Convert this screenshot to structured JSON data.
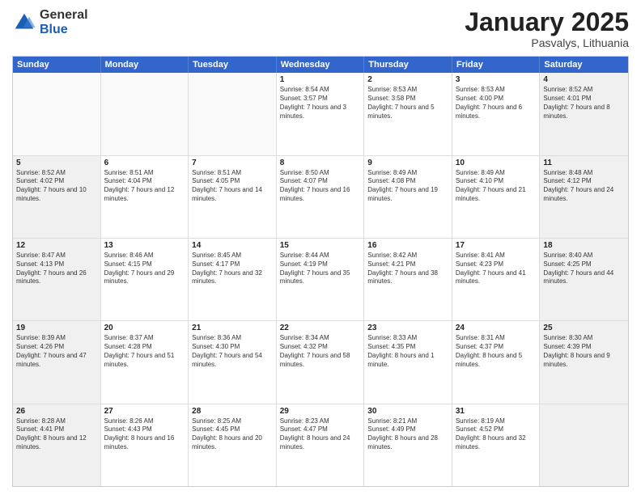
{
  "logo": {
    "general": "General",
    "blue": "Blue"
  },
  "header": {
    "title": "January 2025",
    "subtitle": "Pasvalys, Lithuania"
  },
  "weekdays": [
    "Sunday",
    "Monday",
    "Tuesday",
    "Wednesday",
    "Thursday",
    "Friday",
    "Saturday"
  ],
  "rows": [
    [
      {
        "day": "",
        "empty": true
      },
      {
        "day": "",
        "empty": true
      },
      {
        "day": "",
        "empty": true
      },
      {
        "day": "1",
        "sunrise": "Sunrise: 8:54 AM",
        "sunset": "Sunset: 3:57 PM",
        "daylight": "Daylight: 7 hours and 3 minutes."
      },
      {
        "day": "2",
        "sunrise": "Sunrise: 8:53 AM",
        "sunset": "Sunset: 3:58 PM",
        "daylight": "Daylight: 7 hours and 5 minutes."
      },
      {
        "day": "3",
        "sunrise": "Sunrise: 8:53 AM",
        "sunset": "Sunset: 4:00 PM",
        "daylight": "Daylight: 7 hours and 6 minutes."
      },
      {
        "day": "4",
        "sunrise": "Sunrise: 8:52 AM",
        "sunset": "Sunset: 4:01 PM",
        "daylight": "Daylight: 7 hours and 8 minutes.",
        "shaded": true
      }
    ],
    [
      {
        "day": "5",
        "sunrise": "Sunrise: 8:52 AM",
        "sunset": "Sunset: 4:02 PM",
        "daylight": "Daylight: 7 hours and 10 minutes.",
        "shaded": true
      },
      {
        "day": "6",
        "sunrise": "Sunrise: 8:51 AM",
        "sunset": "Sunset: 4:04 PM",
        "daylight": "Daylight: 7 hours and 12 minutes."
      },
      {
        "day": "7",
        "sunrise": "Sunrise: 8:51 AM",
        "sunset": "Sunset: 4:05 PM",
        "daylight": "Daylight: 7 hours and 14 minutes."
      },
      {
        "day": "8",
        "sunrise": "Sunrise: 8:50 AM",
        "sunset": "Sunset: 4:07 PM",
        "daylight": "Daylight: 7 hours and 16 minutes."
      },
      {
        "day": "9",
        "sunrise": "Sunrise: 8:49 AM",
        "sunset": "Sunset: 4:08 PM",
        "daylight": "Daylight: 7 hours and 19 minutes."
      },
      {
        "day": "10",
        "sunrise": "Sunrise: 8:49 AM",
        "sunset": "Sunset: 4:10 PM",
        "daylight": "Daylight: 7 hours and 21 minutes."
      },
      {
        "day": "11",
        "sunrise": "Sunrise: 8:48 AM",
        "sunset": "Sunset: 4:12 PM",
        "daylight": "Daylight: 7 hours and 24 minutes.",
        "shaded": true
      }
    ],
    [
      {
        "day": "12",
        "sunrise": "Sunrise: 8:47 AM",
        "sunset": "Sunset: 4:13 PM",
        "daylight": "Daylight: 7 hours and 26 minutes.",
        "shaded": true
      },
      {
        "day": "13",
        "sunrise": "Sunrise: 8:46 AM",
        "sunset": "Sunset: 4:15 PM",
        "daylight": "Daylight: 7 hours and 29 minutes."
      },
      {
        "day": "14",
        "sunrise": "Sunrise: 8:45 AM",
        "sunset": "Sunset: 4:17 PM",
        "daylight": "Daylight: 7 hours and 32 minutes."
      },
      {
        "day": "15",
        "sunrise": "Sunrise: 8:44 AM",
        "sunset": "Sunset: 4:19 PM",
        "daylight": "Daylight: 7 hours and 35 minutes."
      },
      {
        "day": "16",
        "sunrise": "Sunrise: 8:42 AM",
        "sunset": "Sunset: 4:21 PM",
        "daylight": "Daylight: 7 hours and 38 minutes."
      },
      {
        "day": "17",
        "sunrise": "Sunrise: 8:41 AM",
        "sunset": "Sunset: 4:23 PM",
        "daylight": "Daylight: 7 hours and 41 minutes."
      },
      {
        "day": "18",
        "sunrise": "Sunrise: 8:40 AM",
        "sunset": "Sunset: 4:25 PM",
        "daylight": "Daylight: 7 hours and 44 minutes.",
        "shaded": true
      }
    ],
    [
      {
        "day": "19",
        "sunrise": "Sunrise: 8:39 AM",
        "sunset": "Sunset: 4:26 PM",
        "daylight": "Daylight: 7 hours and 47 minutes.",
        "shaded": true
      },
      {
        "day": "20",
        "sunrise": "Sunrise: 8:37 AM",
        "sunset": "Sunset: 4:28 PM",
        "daylight": "Daylight: 7 hours and 51 minutes."
      },
      {
        "day": "21",
        "sunrise": "Sunrise: 8:36 AM",
        "sunset": "Sunset: 4:30 PM",
        "daylight": "Daylight: 7 hours and 54 minutes."
      },
      {
        "day": "22",
        "sunrise": "Sunrise: 8:34 AM",
        "sunset": "Sunset: 4:32 PM",
        "daylight": "Daylight: 7 hours and 58 minutes."
      },
      {
        "day": "23",
        "sunrise": "Sunrise: 8:33 AM",
        "sunset": "Sunset: 4:35 PM",
        "daylight": "Daylight: 8 hours and 1 minute."
      },
      {
        "day": "24",
        "sunrise": "Sunrise: 8:31 AM",
        "sunset": "Sunset: 4:37 PM",
        "daylight": "Daylight: 8 hours and 5 minutes."
      },
      {
        "day": "25",
        "sunrise": "Sunrise: 8:30 AM",
        "sunset": "Sunset: 4:39 PM",
        "daylight": "Daylight: 8 hours and 9 minutes.",
        "shaded": true
      }
    ],
    [
      {
        "day": "26",
        "sunrise": "Sunrise: 8:28 AM",
        "sunset": "Sunset: 4:41 PM",
        "daylight": "Daylight: 8 hours and 12 minutes.",
        "shaded": true
      },
      {
        "day": "27",
        "sunrise": "Sunrise: 8:26 AM",
        "sunset": "Sunset: 4:43 PM",
        "daylight": "Daylight: 8 hours and 16 minutes."
      },
      {
        "day": "28",
        "sunrise": "Sunrise: 8:25 AM",
        "sunset": "Sunset: 4:45 PM",
        "daylight": "Daylight: 8 hours and 20 minutes."
      },
      {
        "day": "29",
        "sunrise": "Sunrise: 8:23 AM",
        "sunset": "Sunset: 4:47 PM",
        "daylight": "Daylight: 8 hours and 24 minutes."
      },
      {
        "day": "30",
        "sunrise": "Sunrise: 8:21 AM",
        "sunset": "Sunset: 4:49 PM",
        "daylight": "Daylight: 8 hours and 28 minutes."
      },
      {
        "day": "31",
        "sunrise": "Sunrise: 8:19 AM",
        "sunset": "Sunset: 4:52 PM",
        "daylight": "Daylight: 8 hours and 32 minutes."
      },
      {
        "day": "",
        "empty": true,
        "shaded": true
      }
    ]
  ]
}
